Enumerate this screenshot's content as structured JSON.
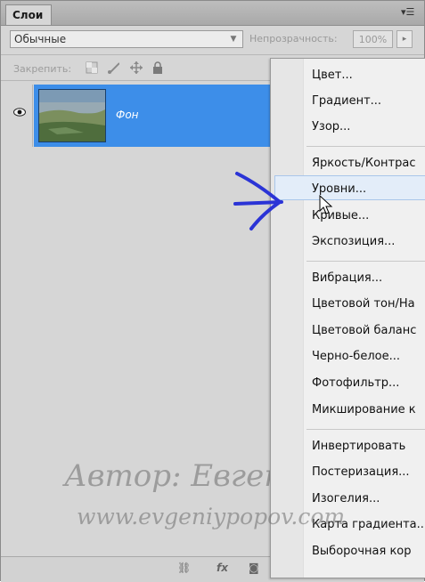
{
  "panel": {
    "tab_title": "Слои",
    "menu_glyph": "▾☰",
    "blend_mode": "Обычные",
    "opacity_label": "Непрозрачность:",
    "opacity_value": "100%",
    "lock_label": "Закрепить:"
  },
  "layer": {
    "name": "Фон"
  },
  "adjustment_menu": {
    "groups": [
      [
        "Цвет...",
        "Градиент...",
        "Узор..."
      ],
      [
        "Яркость/Контрас",
        "Уровни...",
        "Кривые...",
        "Экспозиция..."
      ],
      [
        "Вибрация...",
        "Цветовой тон/На",
        "Цветовой баланс",
        "Черно-белое...",
        "Фотофильтр...",
        "Микширование к"
      ],
      [
        "Инвертировать",
        "Постеризация...",
        "Изогелия...",
        "Карта градиента...",
        "Выборочная кор"
      ]
    ],
    "hovered_item": "Уровни..."
  },
  "watermark": {
    "line1": "Автор: Евгений Попов",
    "line2": "www.evgeniypopov.com"
  },
  "colors": {
    "selection": "#3d8ee9",
    "annotation_arrow": "#2b34d6",
    "panel_bg": "#d6d6d6"
  },
  "icons": [
    "eye-icon",
    "lock-transparency-icon",
    "lock-brush-icon",
    "lock-move-icon",
    "lock-all-icon",
    "link-icon",
    "fx-icon",
    "mask-icon",
    "adjustment-icon",
    "folder-icon",
    "new-layer-icon",
    "trash-icon"
  ]
}
